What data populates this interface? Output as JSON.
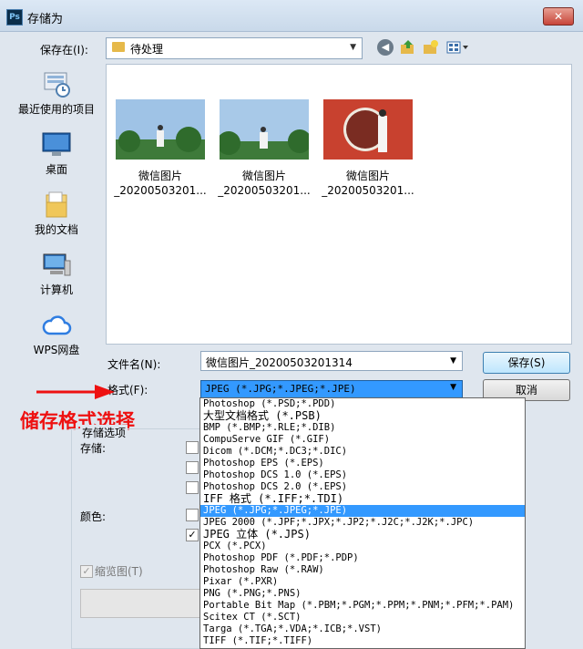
{
  "window": {
    "title": "存储为",
    "app_icon": "Ps",
    "close_label": "✕"
  },
  "save_in": {
    "label": "保存在(I):",
    "path": "待处理"
  },
  "places": [
    {
      "label": "最近使用的项目",
      "icon": "recent-icon"
    },
    {
      "label": "桌面",
      "icon": "desktop-icon"
    },
    {
      "label": "我的文档",
      "icon": "documents-icon"
    },
    {
      "label": "计算机",
      "icon": "computer-icon"
    },
    {
      "label": "WPS网盘",
      "icon": "cloud-icon"
    }
  ],
  "files": [
    {
      "name_line1": "微信图片",
      "name_line2": "_2020050320​1..."
    },
    {
      "name_line1": "微信图片",
      "name_line2": "_2020050320​1..."
    },
    {
      "name_line1": "微信图片",
      "name_line2": "_2020050320​1..."
    }
  ],
  "filename": {
    "label": "文件名(N):",
    "value": "微信图片_20200503201314"
  },
  "format": {
    "label": "格式(F):",
    "value": "JPEG (*.JPG;*.JPEG;*.JPE)"
  },
  "buttons": {
    "save": "保存(S)",
    "cancel": "取消"
  },
  "annotation": "储存格式选择",
  "options": {
    "group_title": "存储选项",
    "save_label": "存储:",
    "color_label": "颜色:",
    "thumbnail_label": "缩览图(T)"
  },
  "format_options": [
    "Photoshop (*.PSD;*.PDD)",
    "大型文档格式 (*.PSB)",
    "BMP (*.BMP;*.RLE;*.DIB)",
    "CompuServe GIF (*.GIF)",
    "Dicom (*.DCM;*.DC3;*.DIC)",
    "Photoshop EPS (*.EPS)",
    "Photoshop DCS 1.0 (*.EPS)",
    "Photoshop DCS 2.0 (*.EPS)",
    "IFF 格式 (*.IFF;*.TDI)",
    "JPEG (*.JPG;*.JPEG;*.JPE)",
    "JPEG 2000 (*.JPF;*.JPX;*.JP2;*.J2C;*.J2K;*.JPC)",
    "JPEG 立体 (*.JPS)",
    "PCX (*.PCX)",
    "Photoshop PDF (*.PDF;*.PDP)",
    "Photoshop Raw (*.RAW)",
    "Pixar (*.PXR)",
    "PNG (*.PNG;*.PNS)",
    "Portable Bit Map (*.PBM;*.PGM;*.PPM;*.PNM;*.PFM;*.PAM)",
    "Scitex CT (*.SCT)",
    "Targa (*.TGA;*.VDA;*.ICB;*.VST)",
    "TIFF (*.TIF;*.TIFF)"
  ],
  "selected_format_index": 9
}
